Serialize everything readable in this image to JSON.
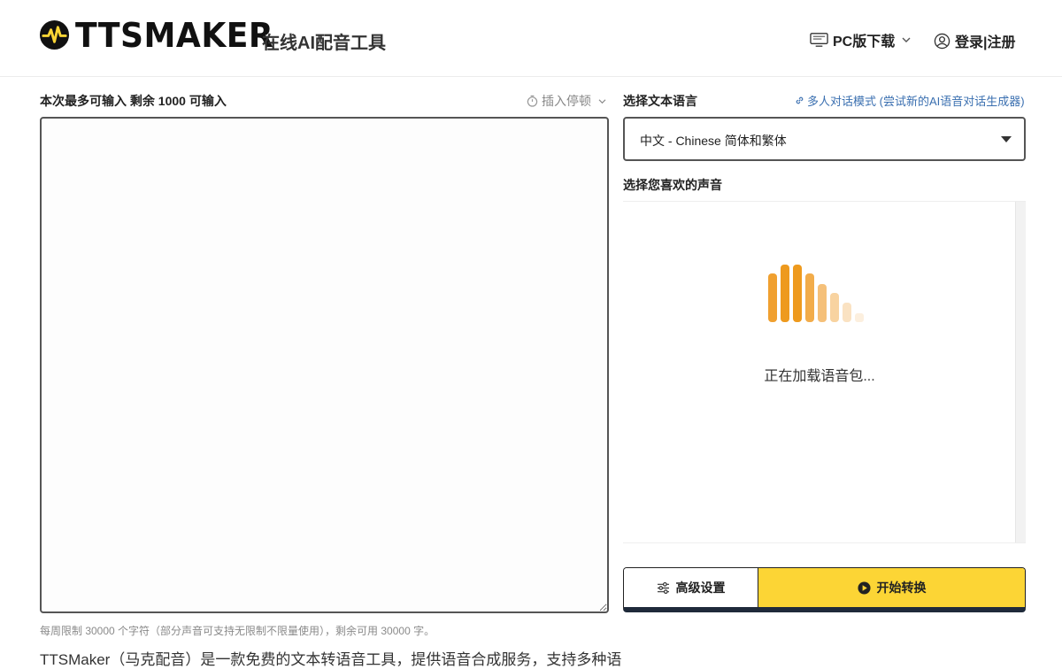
{
  "header": {
    "logo_text": "TTSMAKER",
    "tagline": "在线AI配音工具",
    "pc_download_label": "PC版下载",
    "login_label": "登录|注册"
  },
  "editor": {
    "input_hint": "本次最多可输入 剩余 1000 可输入",
    "insert_pause_label": "插入停顿",
    "text_value": "",
    "weekly_limit": "每周限制 30000 个字符（部分声音可支持无限制不限量使用），剩余可用 30000 字。",
    "intro_text": "TTSMaker（马克配音）是一款免费的文本转语音工具，提供语音合成服务，支持多种语"
  },
  "language": {
    "label": "选择文本语言",
    "multi_speaker_link": "多人对话模式 (尝试新的AI语音对话生成器)",
    "selected": "中文 - Chinese 简体和繁体"
  },
  "voice": {
    "label": "选择您喜欢的声音",
    "loading_text": "正在加载语音包..."
  },
  "actions": {
    "advanced_label": "高级设置",
    "start_label": "开始转换"
  },
  "colors": {
    "accent": "#fcd535",
    "loader": "#f0a030",
    "link": "#3a6fb0"
  }
}
